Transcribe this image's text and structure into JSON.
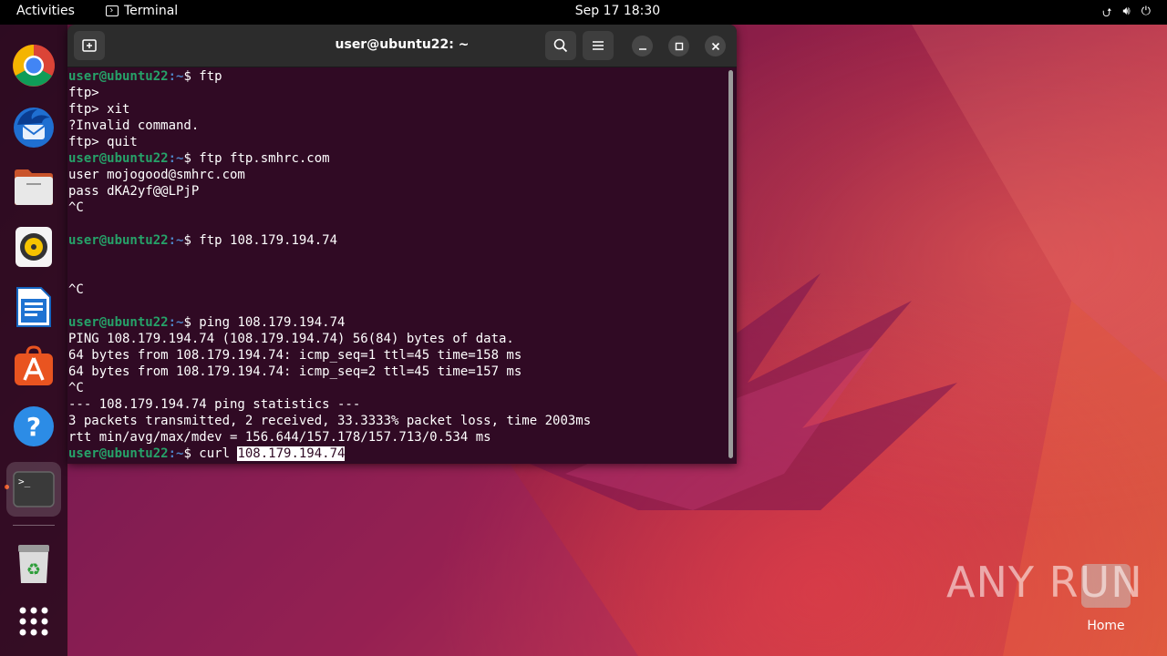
{
  "topbar": {
    "activities": "Activities",
    "app_name": "Terminal",
    "clock": "Sep 17  18:30"
  },
  "dock": {
    "apps": [
      "chrome-icon",
      "thunderbird-icon",
      "files-icon",
      "rhythmbox-icon",
      "writer-icon",
      "app-center-icon",
      "help-icon",
      "terminal-icon",
      "trash-icon",
      "show-apps-icon"
    ]
  },
  "terminal": {
    "title": "user@ubuntu22: ~",
    "prompt_user": "user@ubuntu22",
    "prompt_path": ":~",
    "prompt_sign": "$ ",
    "lines": [
      {
        "type": "prompt",
        "cmd": "ftp"
      },
      {
        "type": "out",
        "text": "ftp>"
      },
      {
        "type": "out",
        "text": "ftp> xit"
      },
      {
        "type": "out",
        "text": "?Invalid command."
      },
      {
        "type": "out",
        "text": "ftp> quit"
      },
      {
        "type": "prompt",
        "cmd": "ftp ftp.smhrc.com"
      },
      {
        "type": "out",
        "text": "user mojogood@smhrc.com"
      },
      {
        "type": "out",
        "text": "pass dKA2yf@@LPjP"
      },
      {
        "type": "out",
        "text": "^C"
      },
      {
        "type": "out",
        "text": ""
      },
      {
        "type": "prompt",
        "cmd": "ftp 108.179.194.74"
      },
      {
        "type": "out",
        "text": ""
      },
      {
        "type": "out",
        "text": ""
      },
      {
        "type": "out",
        "text": "^C"
      },
      {
        "type": "out",
        "text": ""
      },
      {
        "type": "prompt",
        "cmd": "ping 108.179.194.74"
      },
      {
        "type": "out",
        "text": "PING 108.179.194.74 (108.179.194.74) 56(84) bytes of data."
      },
      {
        "type": "out",
        "text": "64 bytes from 108.179.194.74: icmp_seq=1 ttl=45 time=158 ms"
      },
      {
        "type": "out",
        "text": "64 bytes from 108.179.194.74: icmp_seq=2 ttl=45 time=157 ms"
      },
      {
        "type": "out",
        "text": "^C"
      },
      {
        "type": "out",
        "text": "--- 108.179.194.74 ping statistics ---"
      },
      {
        "type": "out",
        "text": "3 packets transmitted, 2 received, 33.3333% packet loss, time 2003ms"
      },
      {
        "type": "out",
        "text": "rtt min/avg/max/mdev = 156.644/157.178/157.713/0.534 ms"
      },
      {
        "type": "prompt",
        "cmd": "curl ",
        "selected": "108.179.194.74"
      }
    ]
  },
  "watermark": {
    "text": "ANY RUN"
  },
  "desktop": {
    "home_label": "Home"
  },
  "colors": {
    "terminal_bg": "#300a24",
    "prompt_user": "#26a269",
    "prompt_path": "#4e83c4",
    "accent": "#e95420"
  }
}
